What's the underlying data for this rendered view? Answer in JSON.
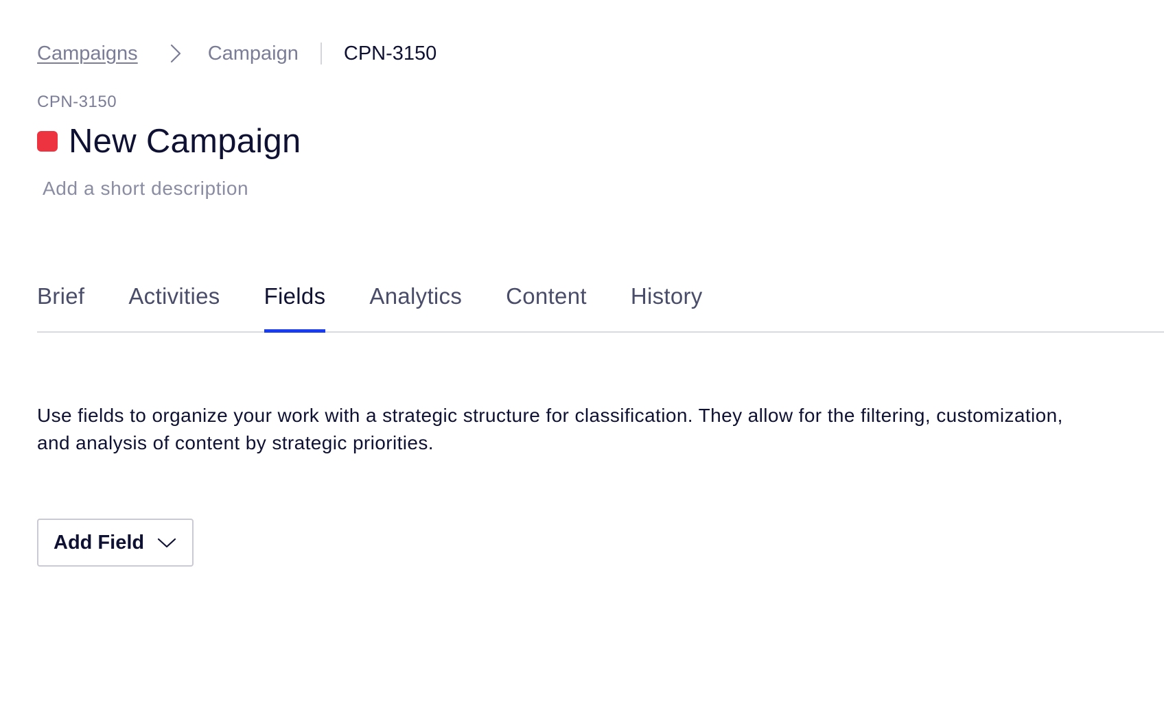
{
  "breadcrumb": {
    "root": "Campaigns",
    "parent": "Campaign",
    "current": "CPN-3150"
  },
  "header": {
    "code": "CPN-3150",
    "title": "New Campaign",
    "swatch_color": "#ee3340",
    "description_placeholder": "Add a short description"
  },
  "tabs": [
    {
      "label": "Brief"
    },
    {
      "label": "Activities"
    },
    {
      "label": "Fields",
      "active": true
    },
    {
      "label": "Analytics"
    },
    {
      "label": "Content"
    },
    {
      "label": "History"
    }
  ],
  "fields_panel": {
    "intro": "Use fields to organize your work with a strategic structure for classification. They allow for the filtering, customization, and analysis of content by strategic priorities.",
    "add_button_label": "Add Field"
  },
  "colors": {
    "accent": "#1a3cf0",
    "text": "#0f1133",
    "muted": "#7a7d95"
  }
}
